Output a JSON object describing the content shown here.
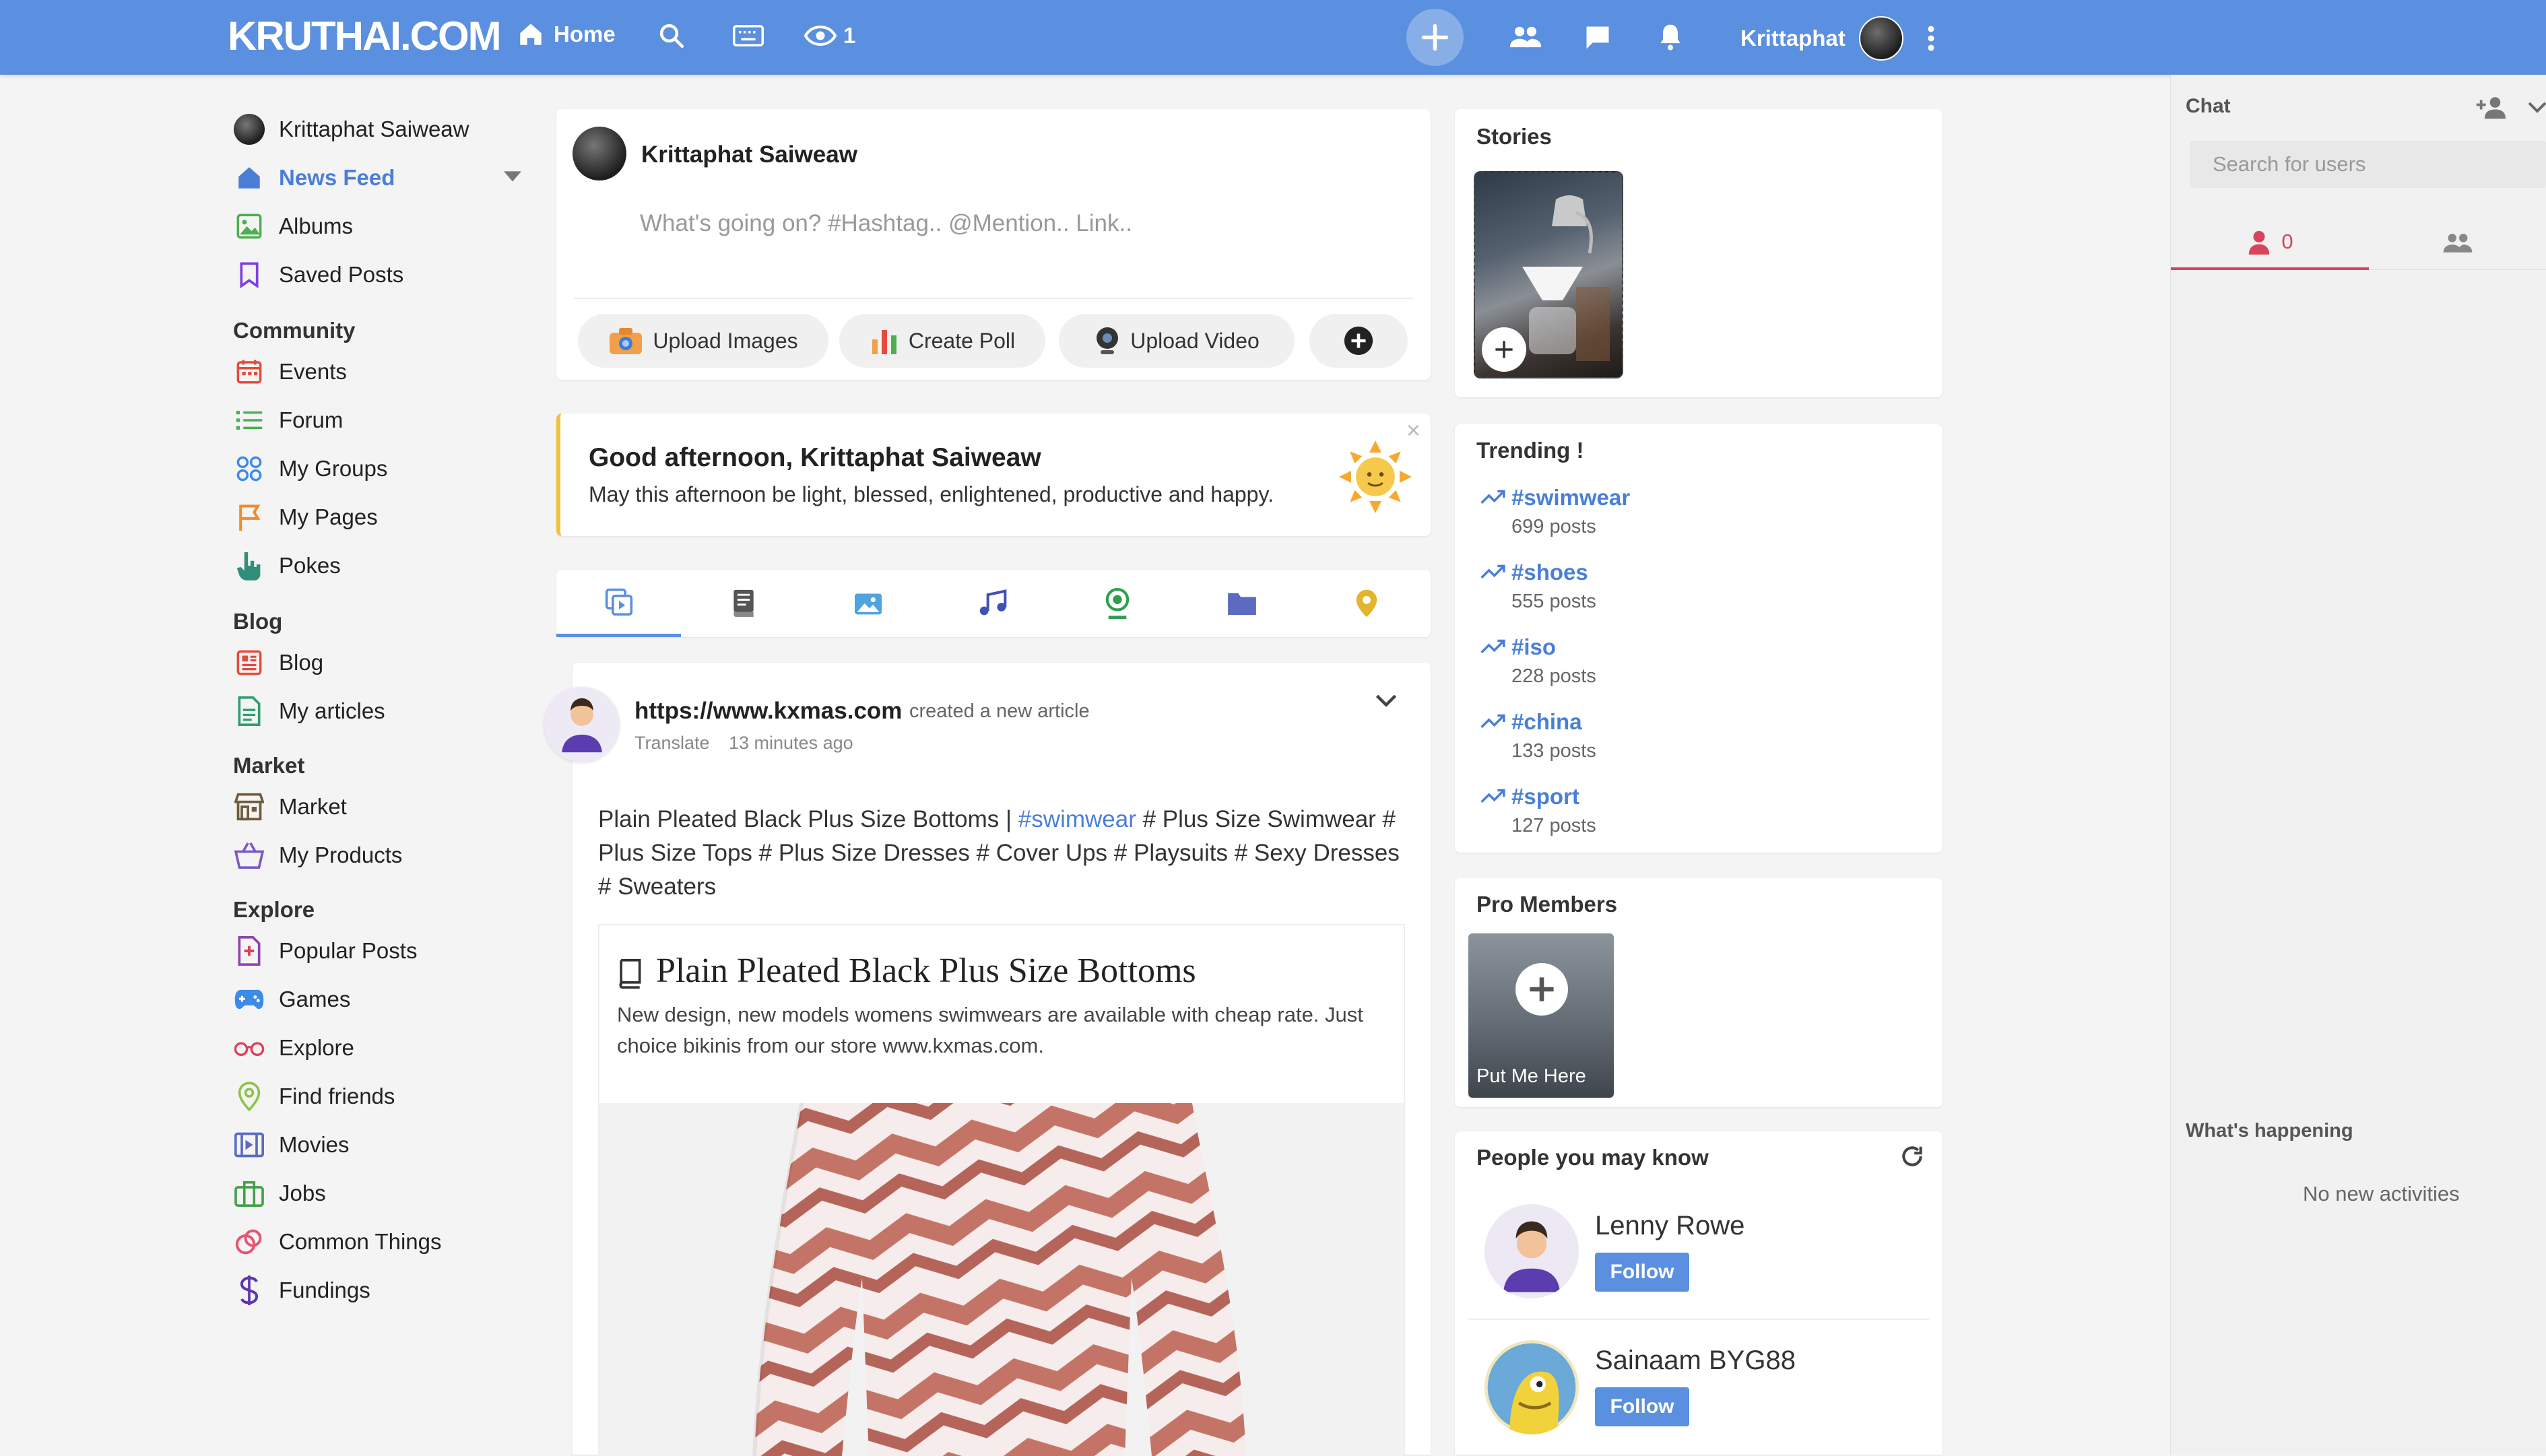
{
  "header": {
    "brand": "KRUTHAI.COM",
    "home": "Home",
    "views": "1",
    "username": "Krittaphat"
  },
  "sidebar": {
    "profile": "Krittaphat Saiweaw",
    "news_feed": "News Feed",
    "albums": "Albums",
    "saved_posts": "Saved Posts",
    "community_head": "Community",
    "events": "Events",
    "forum": "Forum",
    "my_groups": "My Groups",
    "my_pages": "My Pages",
    "pokes": "Pokes",
    "blog_head": "Blog",
    "blog": "Blog",
    "my_articles": "My articles",
    "market_head": "Market",
    "market": "Market",
    "my_products": "My Products",
    "explore_head": "Explore",
    "popular_posts": "Popular Posts",
    "games": "Games",
    "explore": "Explore",
    "find_friends": "Find friends",
    "movies": "Movies",
    "jobs": "Jobs",
    "common_things": "Common Things",
    "fundings": "Fundings"
  },
  "composer": {
    "name": "Krittaphat Saiweaw",
    "placeholder": "What's going on? #Hashtag.. @Mention.. Link..",
    "upload_images": "Upload Images",
    "create_poll": "Create Poll",
    "upload_video": "Upload Video"
  },
  "greeting": {
    "title": "Good afternoon, Krittaphat Saiweaw",
    "message": "May this afternoon be light, blessed, enlightened, productive and happy.",
    "close": "×"
  },
  "post": {
    "author": "https://www.kxmas.com",
    "action": "created a new article",
    "translate": "Translate",
    "time": "13 minutes ago",
    "text_a": "Plain Pleated Black Plus Size Bottoms | ",
    "hashtag": "#swimwear",
    "text_b": " # Plus Size Swimwear # Plus Size Tops # Plus Size Dresses # Cover Ups # Playsuits # Sexy Dresses # Sweaters",
    "article_title": "Plain Pleated Black Plus Size Bottoms",
    "article_desc": "New design, new models womens swimwears are available with cheap rate. Just choice bikinis from our store www.kxmas.com."
  },
  "stories": {
    "title": "Stories"
  },
  "trending": {
    "title": "Trending !",
    "items": [
      {
        "tag": "#swimwear",
        "count": "699 posts"
      },
      {
        "tag": "#shoes",
        "count": "555 posts"
      },
      {
        "tag": "#iso",
        "count": "228 posts"
      },
      {
        "tag": "#china",
        "count": "133 posts"
      },
      {
        "tag": "#sport",
        "count": "127 posts"
      }
    ]
  },
  "pro_members": {
    "title": "Pro Members",
    "put_me": "Put Me Here"
  },
  "people": {
    "title": "People you may know",
    "items": [
      {
        "name": "Lenny Rowe",
        "button": "Follow"
      },
      {
        "name": "Sainaam BYG88",
        "button": "Follow"
      }
    ]
  },
  "chat": {
    "title": "Chat",
    "search_placeholder": "Search for users",
    "online_count": "0",
    "whats_happening": "What's happening",
    "no_activities": "No new activities"
  },
  "colors": {
    "header": "#5b8fdf",
    "link": "#4a7fd6",
    "accent_red": "#d9435b",
    "greeting_border": "#f3c23d"
  }
}
